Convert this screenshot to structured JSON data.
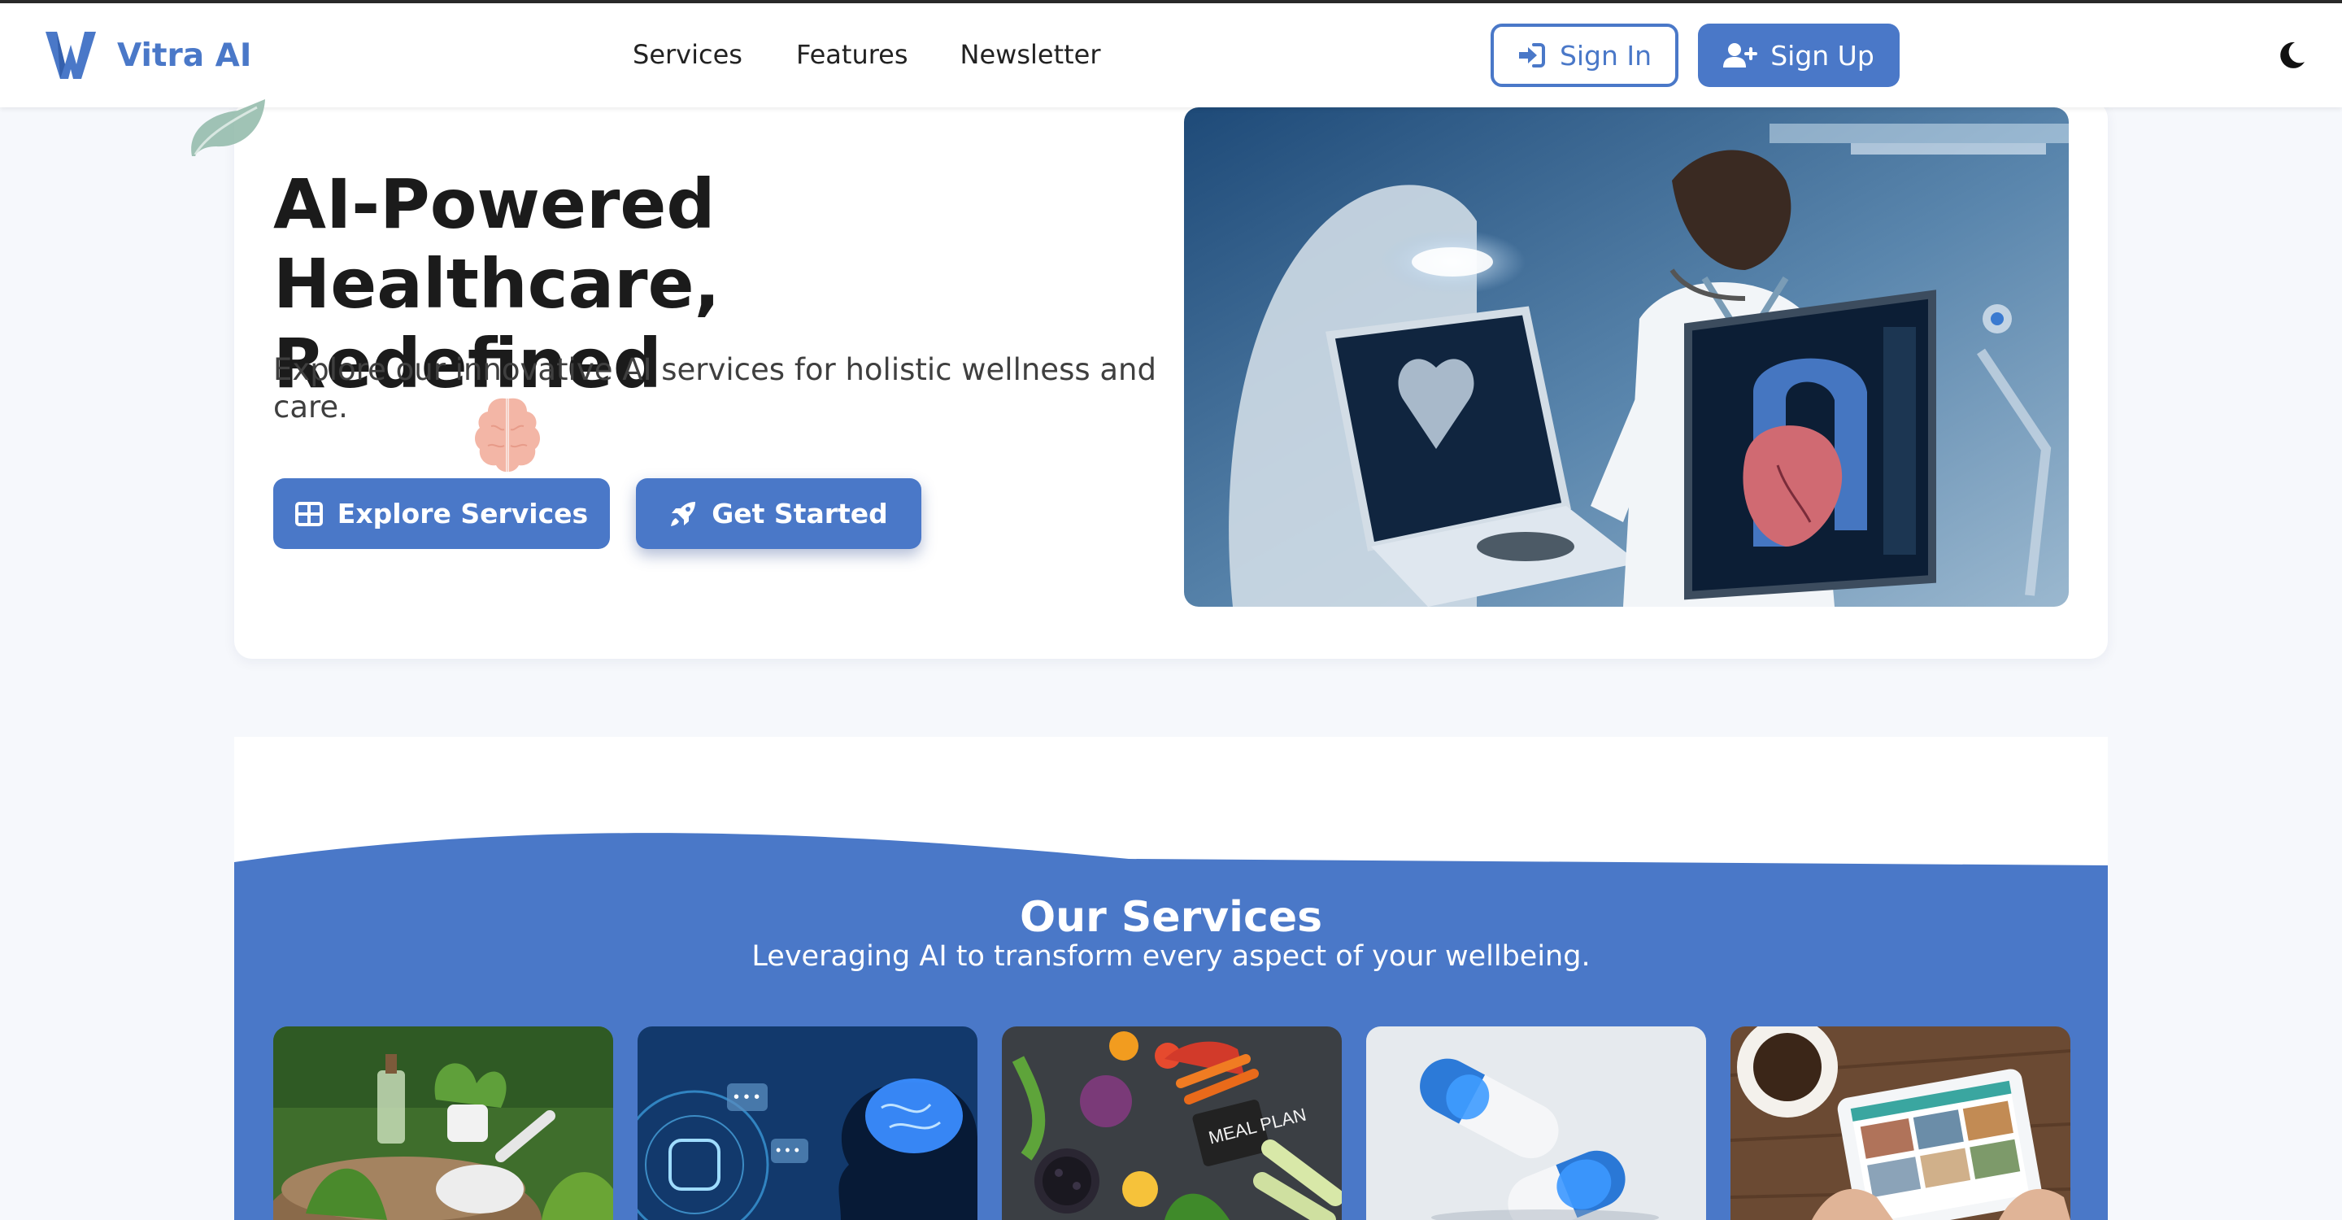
{
  "brand": {
    "name": "Vitra AI",
    "accent_color": "#4a78c8"
  },
  "nav": {
    "links": [
      "Services",
      "Features",
      "Newsletter"
    ],
    "sign_in_label": "Sign In",
    "sign_up_label": "Sign Up",
    "theme_icon": "moon-icon"
  },
  "hero": {
    "title_line1": "AI-Powered Healthcare,",
    "title_line2": "Redefined",
    "subtitle": "Explore our innovative AI services for holistic wellness and care.",
    "explore_label": "Explore Services",
    "started_label": "Get Started",
    "explore_icon": "grid-icon",
    "started_icon": "rocket-icon",
    "image_alt": "Doctor examining a holographic heart on medical AI screens"
  },
  "services": {
    "title": "Our Services",
    "subtitle": "Leveraging AI to transform every aspect of your wellbeing.",
    "background_color": "#4a78c8",
    "cards": [
      {
        "name": "herbal-remedies",
        "image_text": ""
      },
      {
        "name": "ai-mental-health",
        "image_text": ""
      },
      {
        "name": "meal-plan",
        "image_text": "MEAL PLAN"
      },
      {
        "name": "medication",
        "image_text": ""
      },
      {
        "name": "telehealth-tablet",
        "image_text": ""
      }
    ]
  }
}
